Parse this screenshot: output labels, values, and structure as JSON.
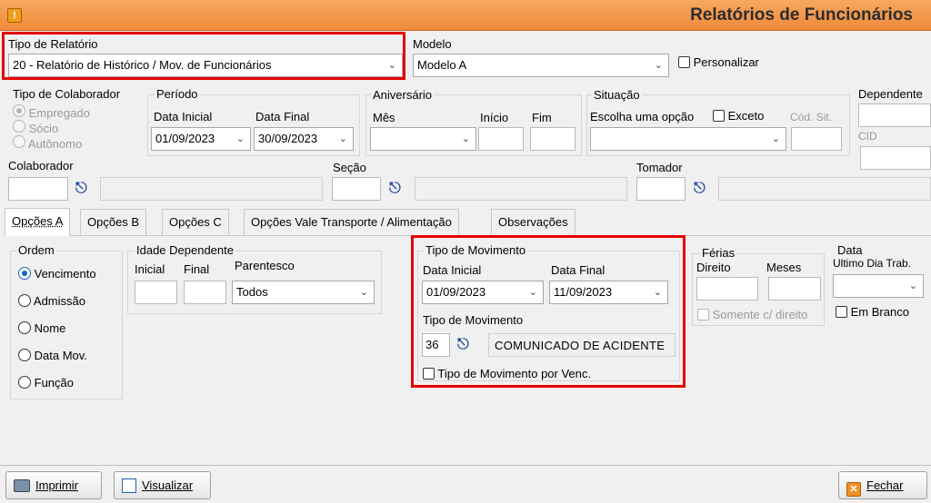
{
  "window": {
    "title": "Relatórios de Funcionários",
    "icon": "!"
  },
  "tipo_relatorio": {
    "label": "Tipo de Relatório",
    "value": "20 - Relatório de  Histórico / Mov. de Funcionários"
  },
  "modelo": {
    "label": "Modelo",
    "value": "Modelo A",
    "personalizar": "Personalizar"
  },
  "tipo_colaborador": {
    "label": "Tipo de Colaborador",
    "options": [
      "Empregado",
      "Sócio",
      "Autônomo"
    ]
  },
  "periodo": {
    "label": "Período",
    "inicial_label": "Data Inicial",
    "final_label": "Data Final",
    "inicial": "01/09/2023",
    "final": "30/09/2023"
  },
  "aniversario": {
    "label": "Aniversário",
    "mes": "Mês",
    "inicio": "Início",
    "fim": "Fim"
  },
  "situacao": {
    "label": "Situação",
    "escolha": "Escolha uma opção",
    "exceto": "Exceto",
    "cod_sit": "Cód. Sit."
  },
  "dependente": {
    "label": "Dependente",
    "cid": "CID"
  },
  "colaborador": {
    "label": "Colaborador"
  },
  "secao": {
    "label": "Seção"
  },
  "tomador": {
    "label": "Tomador"
  },
  "tabs": [
    "Opções A",
    "Opções B",
    "Opções C",
    "Opções Vale Transporte  / Alimentação",
    "Observações"
  ],
  "ordem": {
    "label": "Ordem",
    "options": [
      "Vencimento",
      "Admissão",
      "Nome",
      "Data Mov.",
      "Função"
    ]
  },
  "idade_dependente": {
    "label": "Idade Dependente",
    "inicial": "Inicial",
    "final": "Final",
    "parentesco": "Parentesco",
    "parentesco_value": "Todos"
  },
  "tipo_movimento": {
    "group_label": "Tipo de Movimento",
    "inicial_label": "Data Inicial",
    "final_label": "Data Final",
    "inicial": "01/09/2023",
    "final": "11/09/2023",
    "codigo_label": "Tipo de Movimento",
    "codigo": "36",
    "descricao": "COMUNICADO DE ACIDENTE",
    "por_venc": "Tipo de Movimento por Venc."
  },
  "ferias": {
    "label": "Férias",
    "direito": "Direito",
    "meses": "Meses",
    "somente": "Somente c/ direito"
  },
  "data_ultimo": {
    "label": "Data",
    "sub": "Ultimo Dia Trab.",
    "em_branco": "Em Branco"
  },
  "buttons": {
    "imprimir": "Imprimir",
    "visualizar": "Visualizar",
    "fechar": "Fechar"
  },
  "colors": {
    "accent": "#ef8a3a",
    "highlight": "#e50000",
    "radio": "#1565c0"
  }
}
